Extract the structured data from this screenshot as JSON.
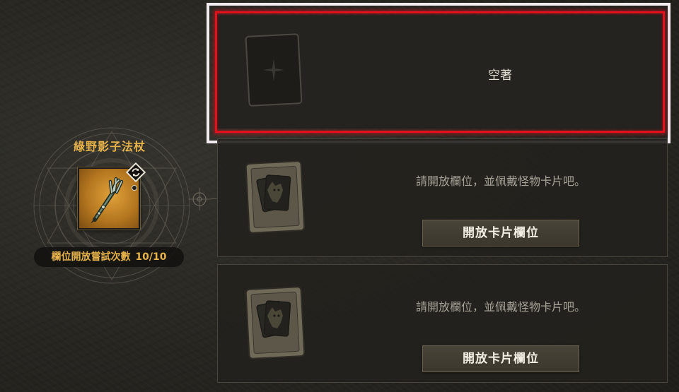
{
  "item": {
    "name": "綠野影子法杖",
    "attempts_label": "欄位開放嘗試次數",
    "attempts_value": "10/10",
    "icon": "staff-icon",
    "swap_icon": "swap-icon"
  },
  "slots": [
    {
      "state": "equipped",
      "status_text": "空著",
      "card_icon": "blank-card-icon"
    },
    {
      "state": "locked",
      "status_text": "請開放欄位，並佩戴怪物卡片吧。",
      "button_label": "開放卡片欄位",
      "card_icon": "monster-card-icon"
    },
    {
      "state": "locked",
      "status_text": "請開放欄位，並佩戴怪物卡片吧。",
      "button_label": "開放卡片欄位",
      "card_icon": "monster-card-icon"
    }
  ],
  "colors": {
    "accent_gold": "#e7b24a",
    "highlight_red": "#e4101b",
    "slot_background": "#24231f"
  }
}
